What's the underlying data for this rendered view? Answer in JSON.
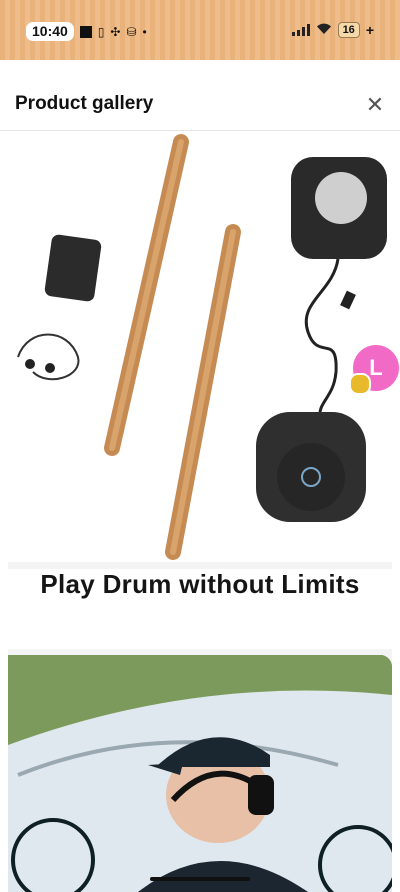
{
  "status_bar": {
    "time": "10:40",
    "battery": "16",
    "icons": [
      "stop-square-icon",
      "battery-saver-icon",
      "fan-icon",
      "database-icon",
      "dot-icon",
      "signal-icon",
      "wifi-icon",
      "charging-plus-icon"
    ]
  },
  "header": {
    "title": "Product gallery",
    "close_icon": "close-icon"
  },
  "gallery": {
    "product_image": "drum-kit-product-image",
    "banner_text": "Play Drum without Limits",
    "lifestyle_image": "man-with-headphones-image"
  },
  "chat_badge": {
    "letter": "L"
  },
  "colors": {
    "status_bar_bg": "#e9b27a",
    "badge_pink": "#f06ac6",
    "wood": "#c98f55"
  }
}
